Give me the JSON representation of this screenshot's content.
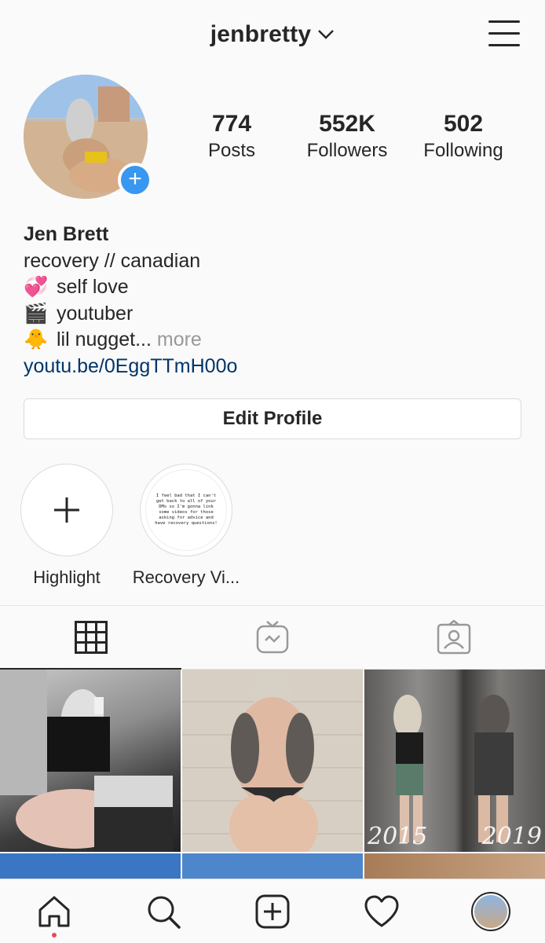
{
  "header": {
    "username": "jenbretty"
  },
  "stats": {
    "posts": {
      "value": "774",
      "label": "Posts"
    },
    "followers": {
      "value": "552K",
      "label": "Followers"
    },
    "following": {
      "value": "502",
      "label": "Following"
    }
  },
  "bio": {
    "name": "Jen Brett",
    "line1": "recovery // canadian",
    "line2_emoji": "💞",
    "line2": "self love",
    "line3_emoji": "🎬",
    "line3": "youtuber",
    "line4_emoji": "🐥",
    "line4": "lil nugget...",
    "more": "more",
    "link": "youtu.be/0EggTTmH00o"
  },
  "edit_profile_label": "Edit Profile",
  "highlights": [
    {
      "label": "Highlight"
    },
    {
      "label": "Recovery Vi...",
      "cover_text": "I feel bad that I can't get back to all of your DMs so I'm gonna link some videos for those asking for advice and have recovery questions!"
    }
  ],
  "grid": {
    "tile3_year_left": "2015",
    "tile3_year_right": "2019"
  },
  "colors": {
    "accent_blue": "#3897f0",
    "link": "#003569",
    "notification_red": "#ed4956"
  },
  "icons": [
    "chevron-down-icon",
    "hamburger-menu-icon",
    "plus-icon",
    "grid-icon",
    "igtv-icon",
    "tagged-icon",
    "home-icon",
    "search-icon",
    "new-post-icon",
    "heart-icon"
  ]
}
